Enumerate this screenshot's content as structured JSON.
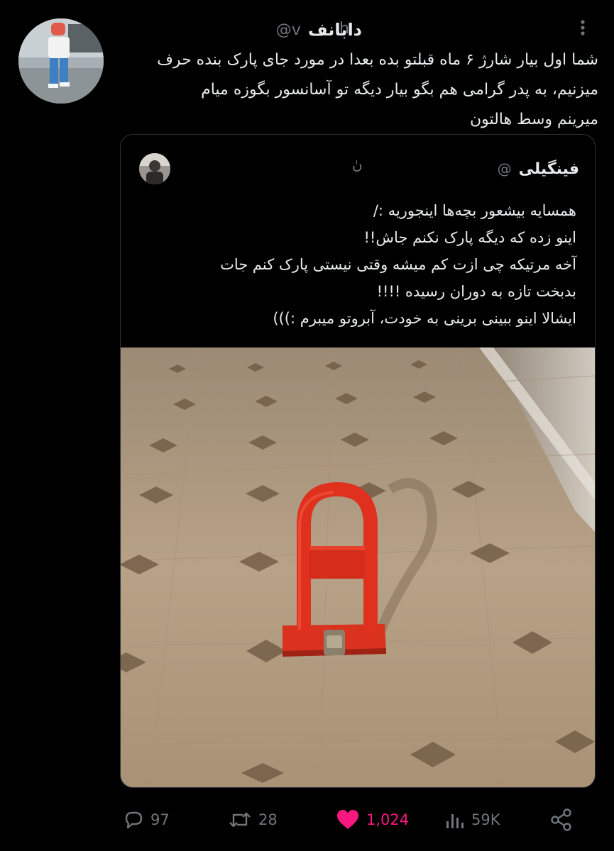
{
  "tweet": {
    "author_name": "دابانف",
    "author_handle_prefix": "@v",
    "author_handle_tail": "h",
    "text": "شما اول بیار شارژ ۶ ماه قبلتو بده بعدا در مورد جای پارک بنده حرف\nمیزنیم، به پدر گرامی هم بگو بیار دیگه تو آسانسور بگوزه میام\nمیرینم وسط هالتون"
  },
  "quote": {
    "author_name": "فینگیلی",
    "author_handle_prefix": "@",
    "author_handle_tail": "ںٰ",
    "text": "همسایه بیشعور بچه‌ها اینجوریه :/\nاینو زده که دیگه پارک نکنم جاش!!\nآخه مرتیکه چی ازت کم میشه وقتی نیستی پارک کنم جات\nبدبخت تازه به دوران رسیده !!!!\nایشالا اینو ببینی برینی به خودت، آبروتو میبرم :)))"
  },
  "photo": {
    "floor_color": "#b39c80",
    "tile_mark_color": "#6f5a44",
    "barrier_color": "#e0311f"
  },
  "actions": {
    "replies": "97",
    "retweets": "28",
    "likes": "1,024",
    "views": "59K"
  },
  "colors": {
    "background": "#000000",
    "text": "#e7e9ea",
    "muted": "#71767b",
    "like": "#f91880",
    "border": "#2f3336"
  },
  "icons": [
    "more-icon",
    "reply-icon",
    "retweet-icon",
    "heart-icon",
    "views-icon",
    "share-icon"
  ]
}
